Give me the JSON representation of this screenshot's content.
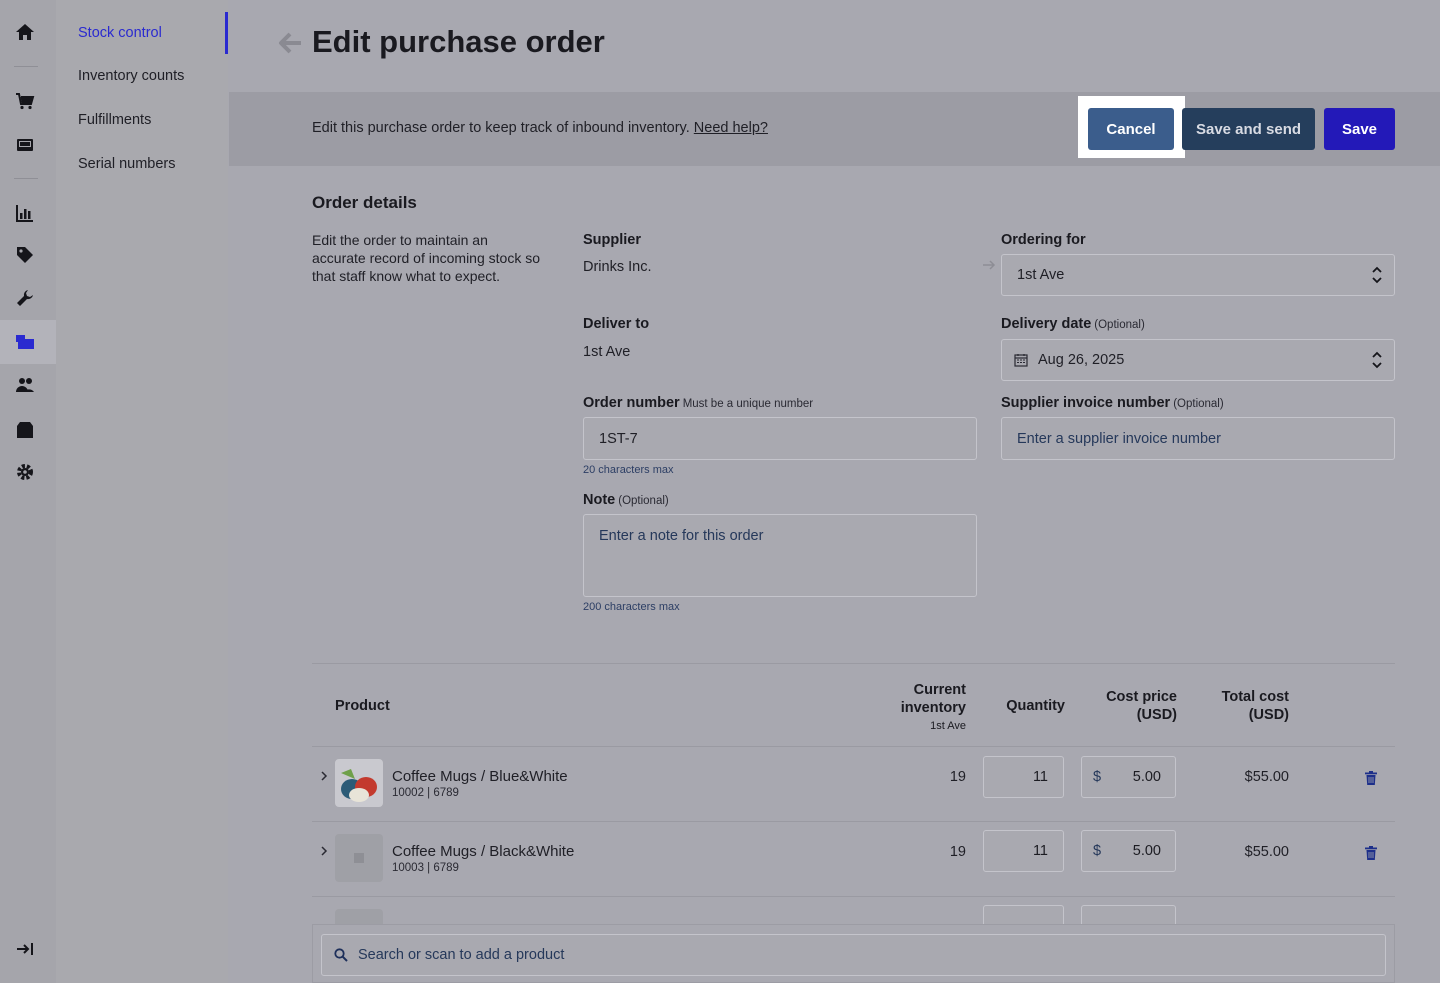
{
  "nav": {
    "sub_items": [
      "Stock control",
      "Inventory counts",
      "Fulfillments",
      "Serial numbers"
    ]
  },
  "header": {
    "title": "Edit purchase order"
  },
  "banner": {
    "text": "Edit this purchase order to keep track of inbound inventory.",
    "link": "Need help?",
    "cancel": "Cancel",
    "save_send": "Save and send",
    "save": "Save"
  },
  "order": {
    "title": "Order details",
    "description": "Edit the order to maintain an accurate record of incoming stock so that staff know what to expect.",
    "supplier_label": "Supplier",
    "supplier_value": "Drinks Inc.",
    "ordering_for_label": "Ordering for",
    "ordering_for_value": "1st Ave",
    "deliver_to_label": "Deliver to",
    "deliver_to_value": "1st Ave",
    "delivery_date_label": "Delivery date",
    "delivery_date_hint": "(Optional)",
    "delivery_date_value": "Aug 26, 2025",
    "order_number_label": "Order number",
    "order_number_hint": "Must be a unique number",
    "order_number_value": "1ST-7",
    "order_number_note": "20 characters max",
    "invoice_label": "Supplier invoice number",
    "invoice_hint": "(Optional)",
    "invoice_placeholder": "Enter a supplier invoice number",
    "note_label": "Note",
    "note_hint": "(Optional)",
    "note_placeholder": "Enter a note for this order",
    "note_note": "200 characters max"
  },
  "table": {
    "headers": {
      "product": "Product",
      "current_inventory": "Current inventory",
      "current_inventory_sub": "1st Ave",
      "quantity": "Quantity",
      "cost_price": "Cost price (USD)",
      "total_cost": "Total cost (USD)"
    },
    "currency_symbol": "$",
    "rows": [
      {
        "name": "Coffee Mugs / Blue&White",
        "sku": "10002 | 6789",
        "inventory": "19",
        "quantity": "11",
        "cost": "5.00",
        "total": "$55.00"
      },
      {
        "name": "Coffee Mugs / Black&White",
        "sku": "10003 | 6789",
        "inventory": "19",
        "quantity": "11",
        "cost": "5.00",
        "total": "$55.00"
      }
    ]
  },
  "search": {
    "placeholder": "Search or scan to add a product"
  },
  "colors": {
    "accent": "#2a2ad0",
    "cancel": "#3b5d8c",
    "save_send": "#253e5c",
    "save": "#2319b8"
  }
}
